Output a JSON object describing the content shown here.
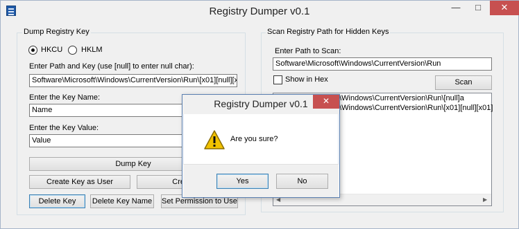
{
  "window": {
    "title": "Registry Dumper v0.1",
    "minimize_glyph": "—",
    "maximize_glyph": "□",
    "close_glyph": "✕"
  },
  "dump": {
    "group_label": "Dump Registry Key",
    "radio_hkcu": "HKCU",
    "radio_hklm": "HKLM",
    "selected_hive": "HKCU",
    "path_label": "Enter Path and Key (use [null] to enter null char):",
    "path_value": "Software\\Microsoft\\Windows\\CurrentVersion\\Run\\[x01][null][x01]",
    "keyname_label": "Enter the Key Name:",
    "keyname_value": "Name",
    "keyvalue_label": "Enter the Key Value:",
    "keyvalue_value": "Value",
    "dump_key_button": "Dump Key",
    "create_user_button": "Create Key as User",
    "create_other_button": "Create K",
    "delete_key_button": "Delete Key",
    "delete_keyname_button": "Delete Key Name",
    "set_permission_button": "Set Permission to User"
  },
  "scan": {
    "group_label": "Scan Registry Path for Hidden Keys",
    "path_label": "Enter Path to Scan:",
    "path_value": "Software\\Microsoft\\Windows\\CurrentVersion\\Run",
    "show_hex_label": "Show in Hex",
    "show_hex_checked": false,
    "scan_button": "Scan",
    "results": [
      "Software\\Microsoft\\Windows\\CurrentVersion\\Run\\[null]a",
      "Software\\Microsoft\\Windows\\CurrentVersion\\Run\\[x01][null][x01]"
    ]
  },
  "dialog": {
    "title": "Registry Dumper v0.1",
    "close_glyph": "✕",
    "message": "Are you sure?",
    "yes_button": "Yes",
    "no_button": "No",
    "icon": "warning-icon"
  },
  "colors": {
    "close_button": "#c75050",
    "focus_border": "#3c7fb1",
    "warning": "#f2c200"
  }
}
